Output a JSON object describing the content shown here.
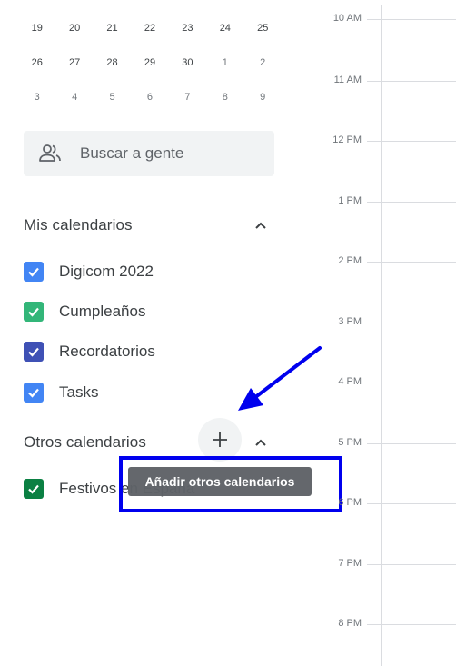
{
  "mini_calendar": {
    "rows": [
      [
        {
          "d": "19",
          "o": false
        },
        {
          "d": "20",
          "o": false
        },
        {
          "d": "21",
          "o": false
        },
        {
          "d": "22",
          "o": false
        },
        {
          "d": "23",
          "o": false
        },
        {
          "d": "24",
          "o": false
        },
        {
          "d": "25",
          "o": false
        }
      ],
      [
        {
          "d": "26",
          "o": false
        },
        {
          "d": "27",
          "o": false
        },
        {
          "d": "28",
          "o": false
        },
        {
          "d": "29",
          "o": false
        },
        {
          "d": "30",
          "o": false
        },
        {
          "d": "1",
          "o": true
        },
        {
          "d": "2",
          "o": true
        }
      ],
      [
        {
          "d": "3",
          "o": true
        },
        {
          "d": "4",
          "o": true
        },
        {
          "d": "5",
          "o": true
        },
        {
          "d": "6",
          "o": true
        },
        {
          "d": "7",
          "o": true
        },
        {
          "d": "8",
          "o": true
        },
        {
          "d": "9",
          "o": true
        }
      ]
    ]
  },
  "search_people": {
    "label": "Buscar a gente",
    "icon": "people-icon"
  },
  "my_calendars": {
    "title": "Mis calendarios",
    "items": [
      {
        "label": "Digicom 2022",
        "color": "#4285f4"
      },
      {
        "label": "Cumpleaños",
        "color": "#33b679"
      },
      {
        "label": "Recordatorios",
        "color": "#3f51b5"
      },
      {
        "label": "Tasks",
        "color": "#4285f4"
      }
    ]
  },
  "other_calendars": {
    "title": "Otros calendarios",
    "add_icon": "plus-icon",
    "tooltip": "Añadir otros calendarios",
    "items": [
      {
        "label": "Festivos en España",
        "color": "#0b8043"
      }
    ]
  },
  "time_grid": {
    "hours": [
      "10 AM",
      "11 AM",
      "12 PM",
      "1 PM",
      "2 PM",
      "3 PM",
      "4 PM",
      "5 PM",
      "6 PM",
      "7 PM",
      "8 PM"
    ]
  },
  "annotation": {
    "arrow_color": "#0000ee",
    "box_color": "#0000ee"
  }
}
